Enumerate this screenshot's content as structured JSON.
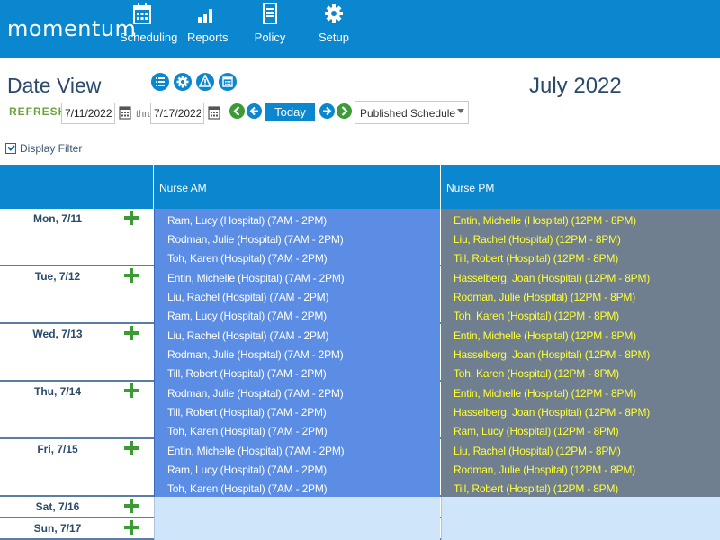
{
  "brand": "momentum",
  "nav": [
    {
      "label": "Scheduling",
      "icon": "calendar-icon"
    },
    {
      "label": "Reports",
      "icon": "bar-chart-icon"
    },
    {
      "label": "Policy",
      "icon": "document-icon"
    },
    {
      "label": "Setup",
      "icon": "gear-icon"
    }
  ],
  "header": {
    "title": "Date View",
    "month": "July 2022",
    "refresh": "REFRESH",
    "start_date": "7/11/2022",
    "thru": "thru",
    "end_date": "7/17/2022",
    "today": "Today",
    "schedule_select": "Published Schedule",
    "filter": "Display Filter"
  },
  "grid": {
    "columns": [
      "Nurse AM",
      "Nurse PM"
    ],
    "days": [
      {
        "label": "Mon, 7/11",
        "am": [
          "Ram, Lucy (Hospital) (7AM - 2PM)",
          "Rodman, Julie (Hospital) (7AM - 2PM)",
          "Toh, Karen (Hospital) (7AM - 2PM)"
        ],
        "pm": [
          "Entin, Michelle (Hospital) (12PM - 8PM)",
          "Liu, Rachel (Hospital) (12PM - 8PM)",
          "Till, Robert (Hospital) (12PM - 8PM)"
        ]
      },
      {
        "label": "Tue, 7/12",
        "am": [
          "Entin, Michelle (Hospital) (7AM - 2PM)",
          "Liu, Rachel (Hospital) (7AM - 2PM)",
          "Ram, Lucy (Hospital) (7AM - 2PM)"
        ],
        "pm": [
          "Hasselberg, Joan (Hospital) (12PM - 8PM)",
          "Rodman, Julie (Hospital) (12PM - 8PM)",
          "Toh, Karen (Hospital) (12PM - 8PM)"
        ]
      },
      {
        "label": "Wed, 7/13",
        "am": [
          "Liu, Rachel (Hospital) (7AM - 2PM)",
          "Rodman, Julie (Hospital) (7AM - 2PM)",
          "Till, Robert (Hospital) (7AM - 2PM)"
        ],
        "pm": [
          "Entin, Michelle (Hospital) (12PM - 8PM)",
          "Hasselberg, Joan (Hospital) (12PM - 8PM)",
          "Toh, Karen (Hospital) (12PM - 8PM)"
        ]
      },
      {
        "label": "Thu, 7/14",
        "am": [
          "Rodman, Julie (Hospital) (7AM - 2PM)",
          "Till, Robert (Hospital) (7AM - 2PM)",
          "Toh, Karen (Hospital) (7AM - 2PM)"
        ],
        "pm": [
          "Entin, Michelle (Hospital) (12PM - 8PM)",
          "Hasselberg, Joan (Hospital) (12PM - 8PM)",
          "Ram, Lucy (Hospital) (12PM - 8PM)"
        ]
      },
      {
        "label": "Fri, 7/15",
        "am": [
          "Entin, Michelle (Hospital) (7AM - 2PM)",
          "Ram, Lucy (Hospital) (7AM - 2PM)",
          "Toh, Karen (Hospital) (7AM - 2PM)"
        ],
        "pm": [
          "Liu, Rachel (Hospital) (12PM - 8PM)",
          "Rodman, Julie (Hospital) (12PM - 8PM)",
          "Till, Robert (Hospital) (12PM - 8PM)"
        ]
      },
      {
        "label": "Sat, 7/16",
        "am": [],
        "pm": []
      },
      {
        "label": "Sun, 7/17",
        "am": [],
        "pm": []
      }
    ]
  },
  "colors": {
    "brand_blue": "#0a87cf",
    "am_shift_bg": "#5b8de4",
    "pm_shift_bg": "#707f8f",
    "pm_shift_text": "#ffff33",
    "add_green": "#3c9b35",
    "empty_cell_bg": "#cfe5fa"
  }
}
